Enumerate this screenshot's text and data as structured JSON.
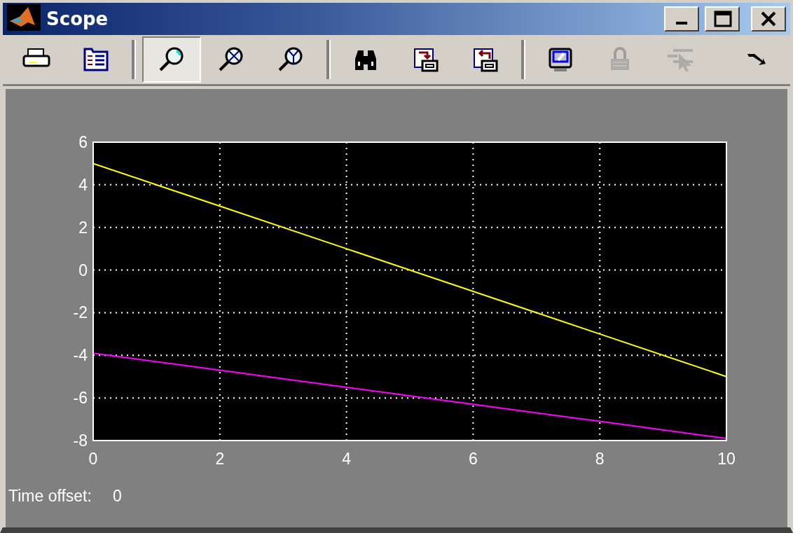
{
  "window": {
    "title": "Scope",
    "controls": [
      {
        "kind": "minimize"
      },
      {
        "kind": "maximize"
      },
      {
        "kind": "close"
      }
    ]
  },
  "toolbar": [
    {
      "kind": "print",
      "selected": false,
      "disabled": false
    },
    {
      "kind": "parameters",
      "selected": false,
      "disabled": false
    },
    {
      "kind": "separator"
    },
    {
      "kind": "zoom",
      "selected": true,
      "disabled": false
    },
    {
      "kind": "zoom-x",
      "selected": false,
      "disabled": false
    },
    {
      "kind": "zoom-y",
      "selected": false,
      "disabled": false
    },
    {
      "kind": "separator"
    },
    {
      "kind": "autoscale",
      "selected": false,
      "disabled": false
    },
    {
      "kind": "save-axes",
      "selected": false,
      "disabled": false
    },
    {
      "kind": "restore-axes",
      "selected": false,
      "disabled": false
    },
    {
      "kind": "separator"
    },
    {
      "kind": "floating",
      "selected": false,
      "disabled": false
    },
    {
      "kind": "lock",
      "selected": false,
      "disabled": true
    },
    {
      "kind": "signal-select",
      "selected": false,
      "disabled": true
    },
    {
      "kind": "dock",
      "selected": false,
      "disabled": false
    }
  ],
  "plot": {
    "chart_data": {
      "type": "line",
      "x": [
        0,
        2,
        4,
        6,
        8,
        10
      ],
      "series": [
        {
          "color": "#ffff00",
          "values": [
            5,
            3,
            1,
            -1,
            -3,
            -5
          ]
        },
        {
          "color": "#ff00ff",
          "values": [
            -3.9,
            -4.7,
            -5.5,
            -6.3,
            -7.1,
            -7.9
          ]
        }
      ],
      "grid": true,
      "xlim": [
        0,
        10
      ],
      "ylim": [
        -8,
        6
      ],
      "xticks": [
        0,
        2,
        4,
        6,
        8,
        10
      ],
      "yticks": [
        -8,
        -6,
        -4,
        -2,
        0,
        2,
        4,
        6
      ]
    }
  },
  "status": {
    "label": "Time offset:",
    "value": "0"
  }
}
